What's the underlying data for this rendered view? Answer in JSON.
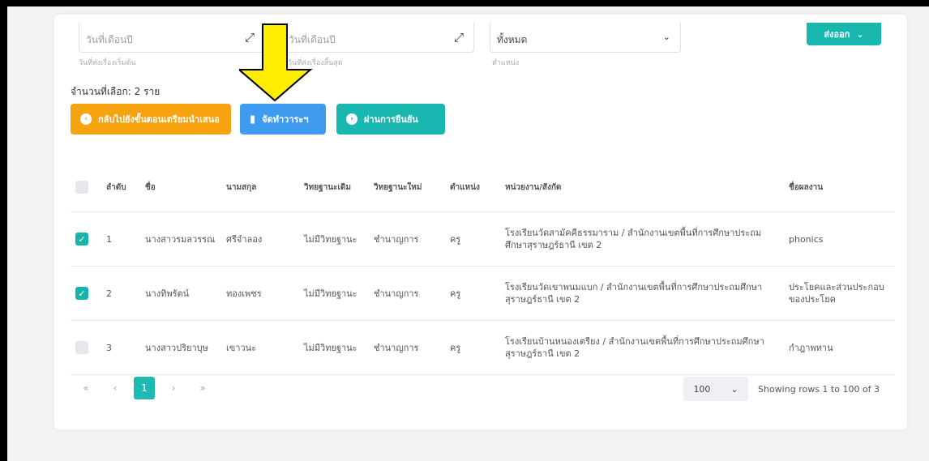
{
  "filters": {
    "date_from": {
      "value": "วันที่เดือนปี",
      "hint": "วันที่ส่งเรื่องเริ่มต้น"
    },
    "date_to": {
      "value": "วันที่เดือนปี",
      "hint": "วันที่ส่งเรื่องสิ้นสุด"
    },
    "position": {
      "value": "ทั้งหมด",
      "hint": "ตำแหน่ง"
    },
    "export_label": "ส่งออก"
  },
  "selection_text": "จำนวนที่เลือก: 2 ราย",
  "actions": {
    "back_label": "กลับไปยังขั้นตอนเตรียมนำเสนอ",
    "document_label": "จัดทำวาระฯ",
    "pass_label": "ผ่านการยืนยัน"
  },
  "colors": {
    "orange": "#f7a20f",
    "blue": "#3f9bef",
    "teal": "#18b7b0",
    "arrow": "#ffee00"
  },
  "table": {
    "headers": [
      "ลำดับ",
      "ชื่อ",
      "นามสกุล",
      "วิทยฐานะเดิม",
      "วิทยฐานะใหม่",
      "ตำแหน่ง",
      "หน่วยงาน/สังกัด",
      "ชื่อผลงาน"
    ],
    "rows": [
      {
        "checked": true,
        "no": "1",
        "name": "นางสาวรมลวรรณ",
        "surname": "ศรีจำลอง",
        "old": "ไม่มีวิทยฐานะ",
        "new": "ชำนาญการ",
        "pos": "ครู",
        "org": "โรงเรียนวัดสามัคคีธรรมาราม / สำนักงานเขตพื้นที่การศึกษาประถมศึกษาสุราษฎร์ธานี เขต 2",
        "work": "phonics"
      },
      {
        "checked": true,
        "no": "2",
        "name": "นางทิพรัตน์",
        "surname": "ทองเพชร",
        "old": "ไม่มีวิทยฐานะ",
        "new": "ชำนาญการ",
        "pos": "ครู",
        "org": "โรงเรียนวัดเขาพนมแบก / สำนักงานเขตพื้นที่การศึกษาประถมศึกษาสุราษฎร์ธานี เขต 2",
        "work": "ประโยคและส่วนประกอบของประโยค"
      },
      {
        "checked": false,
        "no": "3",
        "name": "นางสาวปริยาบุษ",
        "surname": "เขาวนะ",
        "old": "ไม่มีวิทยฐานะ",
        "new": "ชำนาญการ",
        "pos": "ครู",
        "org": "โรงเรียนบ้านหนองเตรียง / สำนักงานเขตพื้นที่การศึกษาประถมศึกษาสุราษฎร์ธานี เขต 2",
        "work": "กำฎาพทาน"
      }
    ]
  },
  "pager": {
    "first": "«",
    "prev": "‹",
    "current": "1",
    "next": "›",
    "last": "»",
    "page_size": "100",
    "showing": "Showing rows 1 to 100 of 3"
  }
}
